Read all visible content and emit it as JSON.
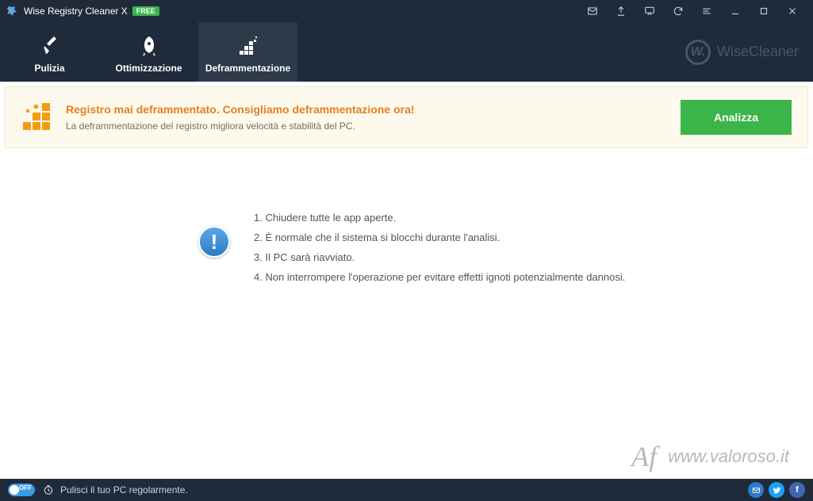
{
  "titlebar": {
    "title": "Wise Registry Cleaner X",
    "badge": "FREE"
  },
  "tabs": {
    "clean": "Pulizia",
    "optimize": "Ottimizzazione",
    "defrag": "Deframmentazione"
  },
  "brand": {
    "logo": "W.",
    "text": "WiseCleaner"
  },
  "banner": {
    "title": "Registro mai deframmentato. Consigliamo deframmentazione ora!",
    "subtitle": "La deframmentazione del registro migliora velocità e stabilità del PC.",
    "button": "Analizza"
  },
  "steps": {
    "s1": "1. Chiudere tutte le app aperte.",
    "s2": "2. È normale che il sistema si blocchi durante l'analisi.",
    "s3": "3. Il PC sarà riavviato.",
    "s4": "4. Non interrompere l'operazione per evitare effetti ignoti potenzialmente dannosi."
  },
  "watermark": {
    "sig": "Af",
    "url": "www.valoroso.it"
  },
  "statusbar": {
    "toggle": "OFF",
    "text": "Pulisci il tuo PC regolarmente."
  }
}
